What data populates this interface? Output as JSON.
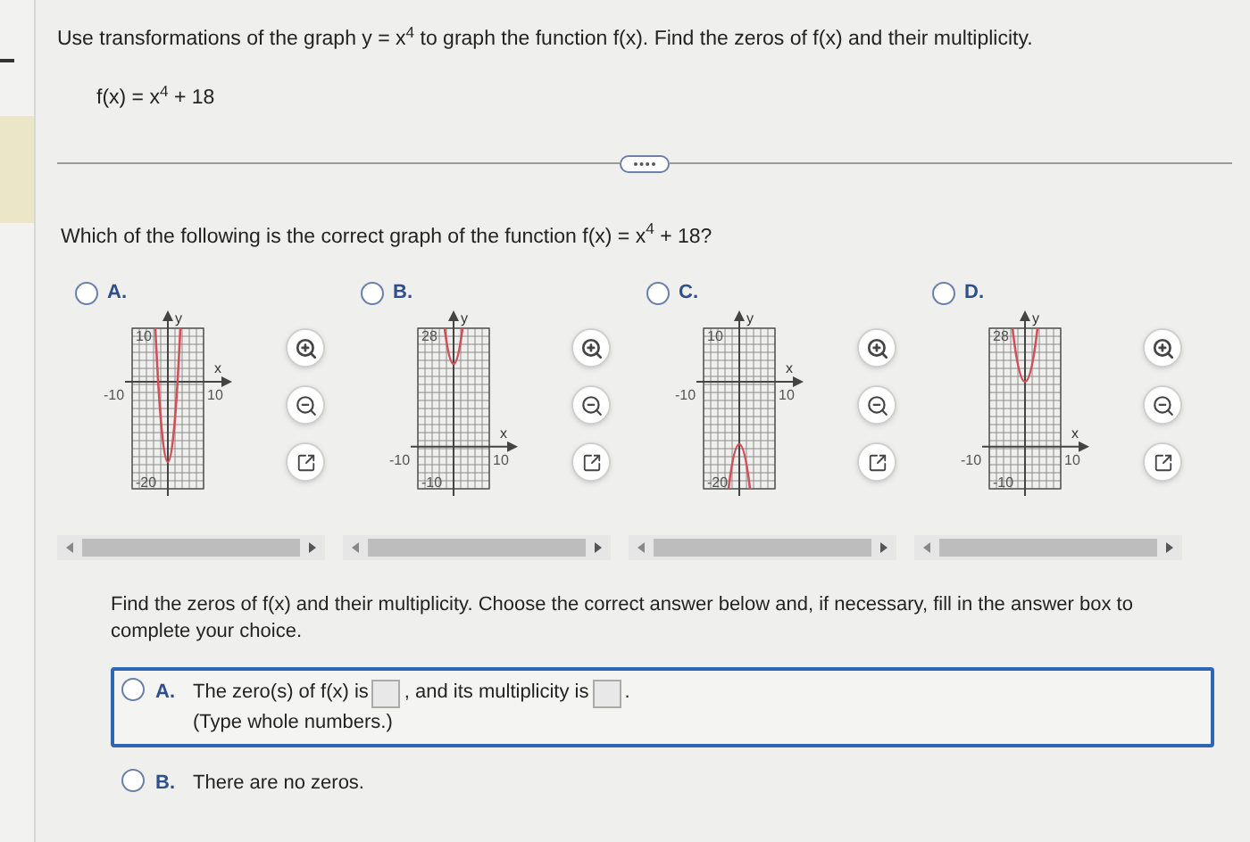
{
  "question": "Use transformations of the graph y = x$^{4}$ to graph the function f(x). Find the zeros of f(x) and their multiplicity.",
  "function": "f(x) = x$^{4}$ + 18",
  "part1": {
    "prompt": "Which of the following is the correct graph of the function f(x) = x$^{4}$ + 18?",
    "options": [
      {
        "label": "A.",
        "selected": false,
        "graph": {
          "kind": "deep-up",
          "y_label": "y",
          "x_label": "x",
          "y_max": "10",
          "y_min": "-20",
          "x_min": "-10",
          "x_max": "10"
        }
      },
      {
        "label": "B.",
        "selected": false,
        "graph": {
          "kind": "high-up-narrow",
          "y_label": "y",
          "x_label": "x",
          "y_max": "28",
          "y_min": "-10",
          "x_min": "-10",
          "x_max": "10"
        }
      },
      {
        "label": "C.",
        "selected": false,
        "graph": {
          "kind": "low-down",
          "y_label": "y",
          "x_label": "x",
          "y_max": "10",
          "y_min": "-20",
          "x_min": "-10",
          "x_max": "10"
        }
      },
      {
        "label": "D.",
        "selected": false,
        "graph": {
          "kind": "high-up",
          "y_label": "y",
          "x_label": "x",
          "y_max": "28",
          "y_min": "-10",
          "x_min": "-10",
          "x_max": "10"
        }
      }
    ]
  },
  "part2": {
    "prompt": "Find the zeros of f(x) and their multiplicity. Choose the correct answer below and, if necessary, fill in the answer box to complete your choice.",
    "options": [
      {
        "kind": "fill",
        "label": "A.",
        "selected": false,
        "highlighted": true,
        "text_1": "The zero(s) of f(x) is",
        "text_2": ", and its multiplicity is",
        "text_3": ".",
        "hint": "(Type whole numbers.)"
      },
      {
        "kind": "plain",
        "label": "B.",
        "selected": false,
        "highlighted": false,
        "text_1": "There are no zeros."
      }
    ]
  }
}
